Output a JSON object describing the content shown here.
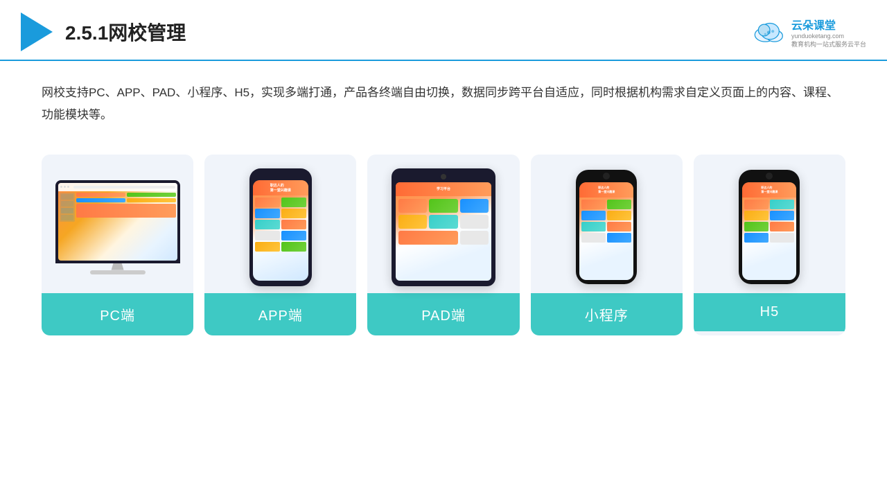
{
  "header": {
    "title": "2.5.1网校管理",
    "brand_name": "云朵课堂",
    "brand_url": "yunduoketang.com",
    "brand_tagline_line1": "教育机构一站",
    "brand_tagline_line2": "式服务云平台"
  },
  "description": {
    "text": "网校支持PC、APP、PAD、小程序、H5，实现多端打通，产品各终端自由切换，数据同步跨平台自适应，同时根据机构需求自定义页面上的内容、课程、功能模块等。"
  },
  "cards": [
    {
      "label": "PC端",
      "type": "pc"
    },
    {
      "label": "APP端",
      "type": "phone"
    },
    {
      "label": "PAD端",
      "type": "tablet"
    },
    {
      "label": "小程序",
      "type": "phone"
    },
    {
      "label": "H5",
      "type": "phone"
    }
  ]
}
